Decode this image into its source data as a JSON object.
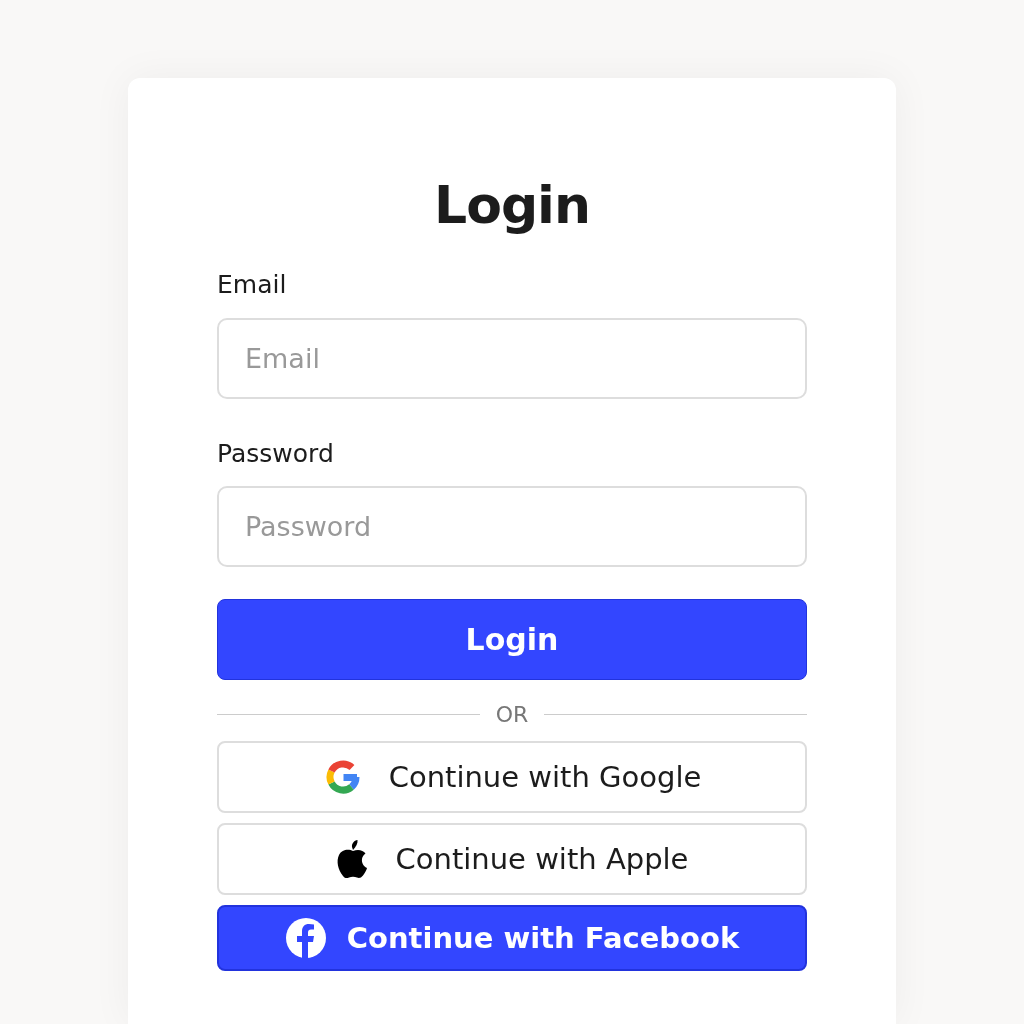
{
  "title": "Login",
  "fields": [
    {
      "label": "Email",
      "placeholder": "Email"
    },
    {
      "label": "Password",
      "placeholder": "Password"
    }
  ],
  "submit": "Login",
  "divider": "OR",
  "providers": [
    {
      "kind": "google",
      "label": "Continue with Google"
    },
    {
      "kind": "apple",
      "label": "Continue with Apple"
    },
    {
      "kind": "facebook",
      "label": "Continue with Facebook"
    }
  ]
}
